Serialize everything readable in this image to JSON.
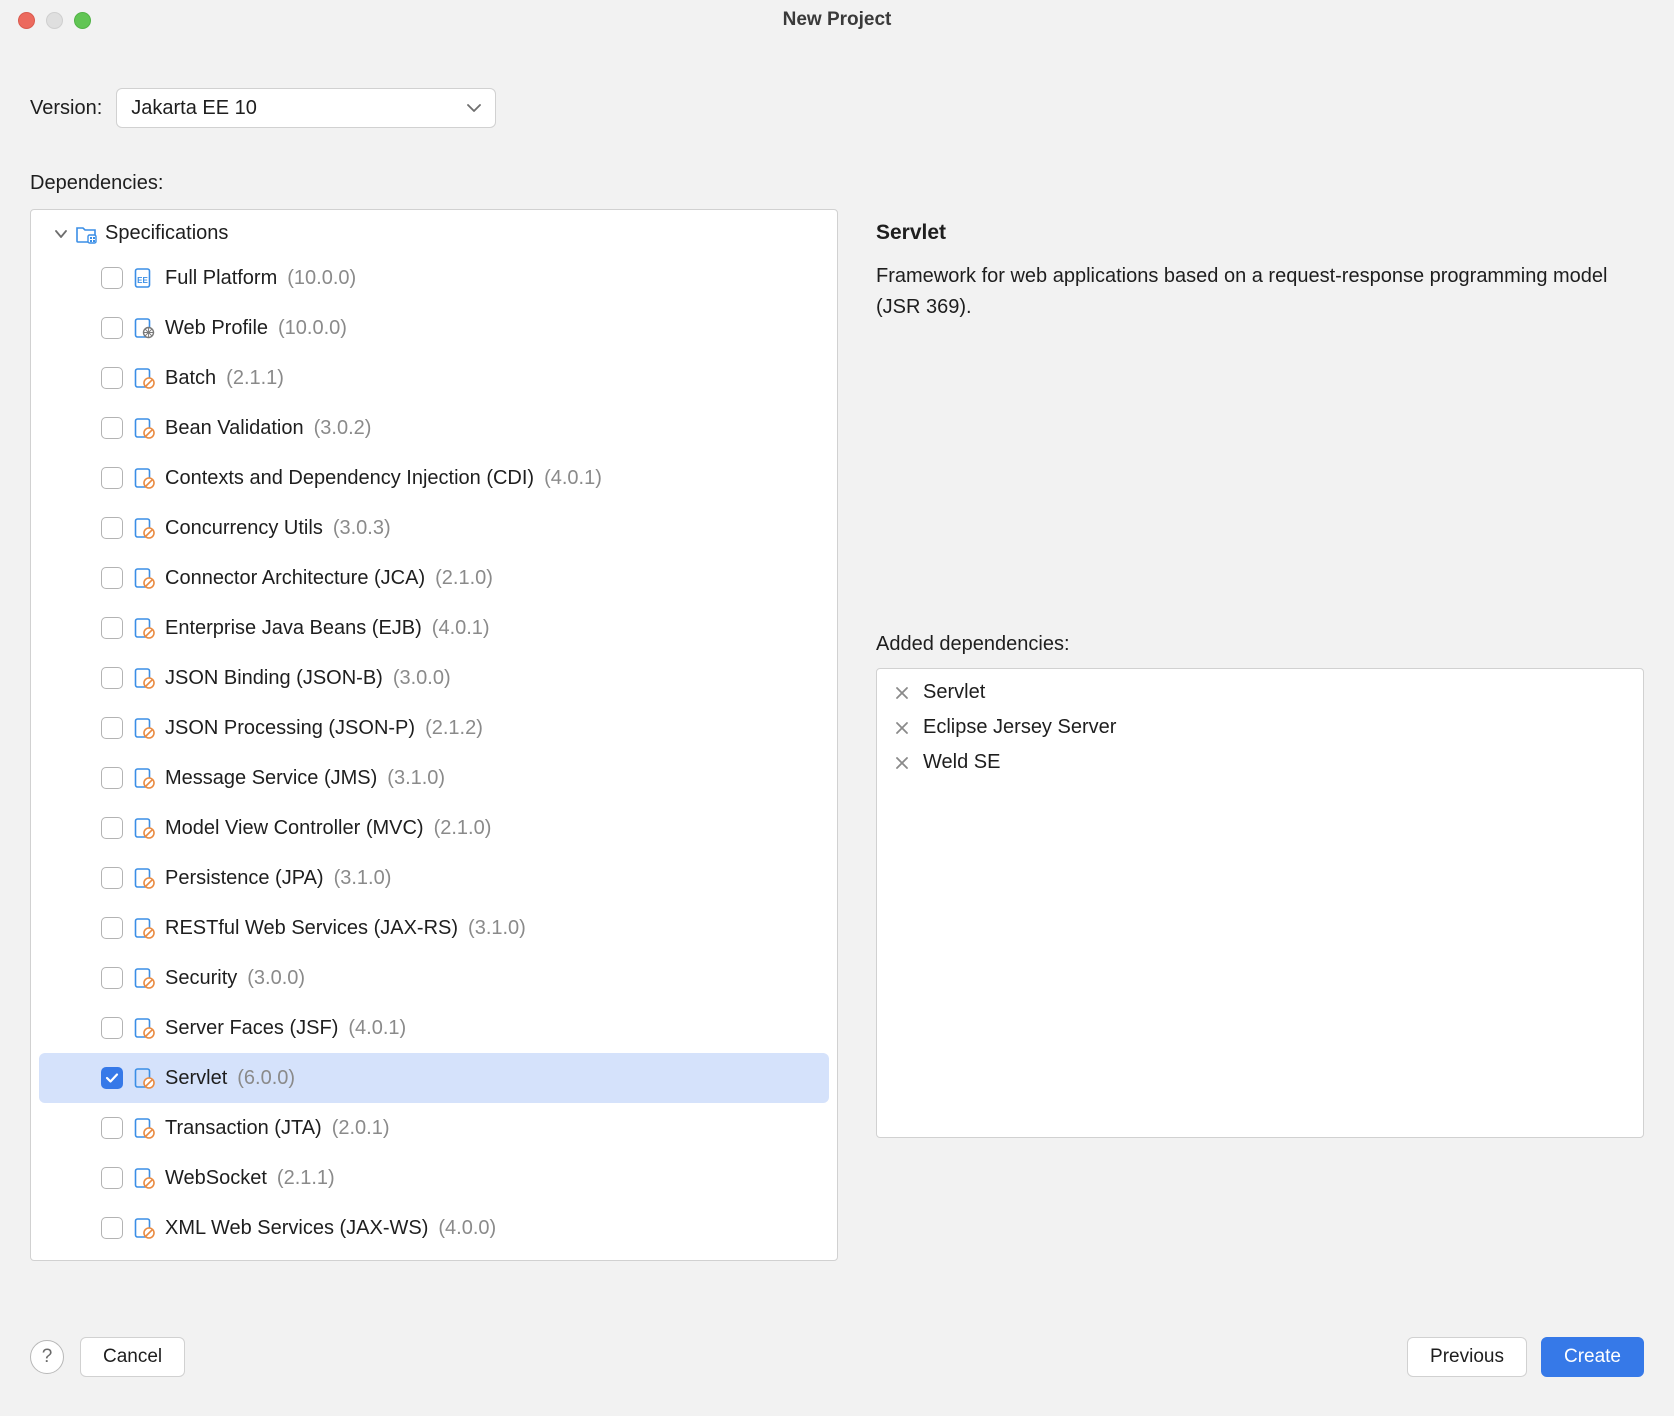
{
  "window": {
    "title": "New Project"
  },
  "form": {
    "version_label": "Version:",
    "version_value": "Jakarta EE 10",
    "dependencies_label": "Dependencies:"
  },
  "tree": {
    "group_label": "Specifications",
    "items": [
      {
        "name": "Full Platform",
        "version": "(10.0.0)",
        "checked": false,
        "selected": false,
        "icon": "ee"
      },
      {
        "name": "Web Profile",
        "version": "(10.0.0)",
        "checked": false,
        "selected": false,
        "icon": "globe"
      },
      {
        "name": "Batch",
        "version": "(2.1.1)",
        "checked": false,
        "selected": false,
        "icon": "page"
      },
      {
        "name": "Bean Validation",
        "version": "(3.0.2)",
        "checked": false,
        "selected": false,
        "icon": "page"
      },
      {
        "name": "Contexts and Dependency Injection (CDI)",
        "version": "(4.0.1)",
        "checked": false,
        "selected": false,
        "icon": "page"
      },
      {
        "name": "Concurrency Utils",
        "version": "(3.0.3)",
        "checked": false,
        "selected": false,
        "icon": "page"
      },
      {
        "name": "Connector Architecture (JCA)",
        "version": "(2.1.0)",
        "checked": false,
        "selected": false,
        "icon": "page"
      },
      {
        "name": "Enterprise Java Beans (EJB)",
        "version": "(4.0.1)",
        "checked": false,
        "selected": false,
        "icon": "page"
      },
      {
        "name": "JSON Binding (JSON-B)",
        "version": "(3.0.0)",
        "checked": false,
        "selected": false,
        "icon": "page"
      },
      {
        "name": "JSON Processing (JSON-P)",
        "version": "(2.1.2)",
        "checked": false,
        "selected": false,
        "icon": "page"
      },
      {
        "name": "Message Service (JMS)",
        "version": "(3.1.0)",
        "checked": false,
        "selected": false,
        "icon": "page"
      },
      {
        "name": "Model View Controller (MVC)",
        "version": "(2.1.0)",
        "checked": false,
        "selected": false,
        "icon": "page"
      },
      {
        "name": "Persistence (JPA)",
        "version": "(3.1.0)",
        "checked": false,
        "selected": false,
        "icon": "page"
      },
      {
        "name": "RESTful Web Services (JAX-RS)",
        "version": "(3.1.0)",
        "checked": false,
        "selected": false,
        "icon": "page"
      },
      {
        "name": "Security",
        "version": "(3.0.0)",
        "checked": false,
        "selected": false,
        "icon": "page"
      },
      {
        "name": "Server Faces (JSF)",
        "version": "(4.0.1)",
        "checked": false,
        "selected": false,
        "icon": "page"
      },
      {
        "name": "Servlet",
        "version": "(6.0.0)",
        "checked": true,
        "selected": true,
        "icon": "page"
      },
      {
        "name": "Transaction (JTA)",
        "version": "(2.0.1)",
        "checked": false,
        "selected": false,
        "icon": "page"
      },
      {
        "name": "WebSocket",
        "version": "(2.1.1)",
        "checked": false,
        "selected": false,
        "icon": "page"
      },
      {
        "name": "XML Web Services (JAX-WS)",
        "version": "(4.0.0)",
        "checked": false,
        "selected": false,
        "icon": "page"
      }
    ]
  },
  "detail": {
    "title": "Servlet",
    "description": "Framework for web applications based on a request-response programming model (JSR 369)."
  },
  "added": {
    "label": "Added dependencies:",
    "items": [
      {
        "name": "Servlet"
      },
      {
        "name": "Eclipse Jersey Server"
      },
      {
        "name": "Weld SE"
      }
    ]
  },
  "footer": {
    "cancel": "Cancel",
    "previous": "Previous",
    "create": "Create"
  }
}
